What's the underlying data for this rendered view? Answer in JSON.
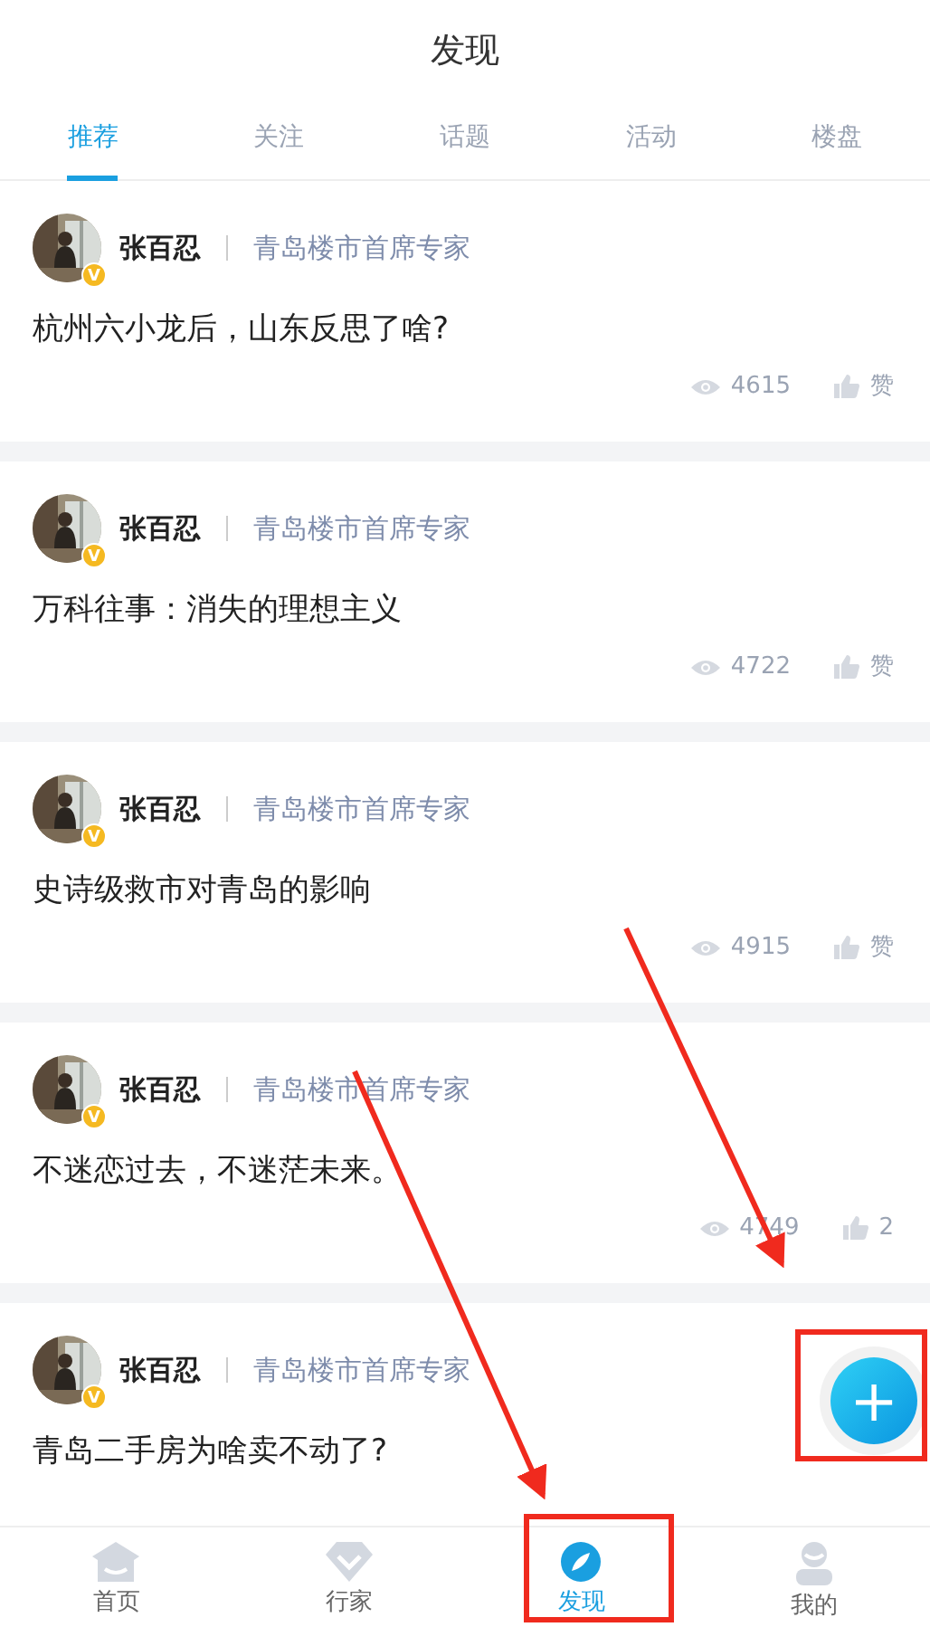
{
  "header": {
    "title": "发现"
  },
  "tabs": [
    {
      "label": "推荐",
      "selected": true
    },
    {
      "label": "关注",
      "selected": false
    },
    {
      "label": "话题",
      "selected": false
    },
    {
      "label": "活动",
      "selected": false
    },
    {
      "label": "楼盘",
      "selected": false
    }
  ],
  "posts": [
    {
      "author": "张百忍",
      "badge": "V",
      "role": "青岛楼市首席专家",
      "title": "杭州六小龙后，山东反思了啥?",
      "views": "4615",
      "likes": "赞"
    },
    {
      "author": "张百忍",
      "badge": "V",
      "role": "青岛楼市首席专家",
      "title": "万科往事：消失的理想主义",
      "views": "4722",
      "likes": "赞"
    },
    {
      "author": "张百忍",
      "badge": "V",
      "role": "青岛楼市首席专家",
      "title": "史诗级救市对青岛的影响",
      "views": "4915",
      "likes": "赞"
    },
    {
      "author": "张百忍",
      "badge": "V",
      "role": "青岛楼市首席专家",
      "title": "不迷恋过去，不迷茫未来。",
      "views": "4749",
      "likes": "2"
    },
    {
      "author": "张百忍",
      "badge": "V",
      "role": "青岛楼市首席专家",
      "title": "青岛二手房为啥卖不动了?"
    }
  ],
  "fab": {
    "label": "+"
  },
  "bottom_nav": [
    {
      "label": "首页",
      "kind": "home",
      "selected": false
    },
    {
      "label": "行家",
      "kind": "diamond",
      "selected": false
    },
    {
      "label": "发现",
      "kind": "compass",
      "selected": true
    },
    {
      "label": "我的",
      "kind": "user",
      "selected": false
    }
  ]
}
